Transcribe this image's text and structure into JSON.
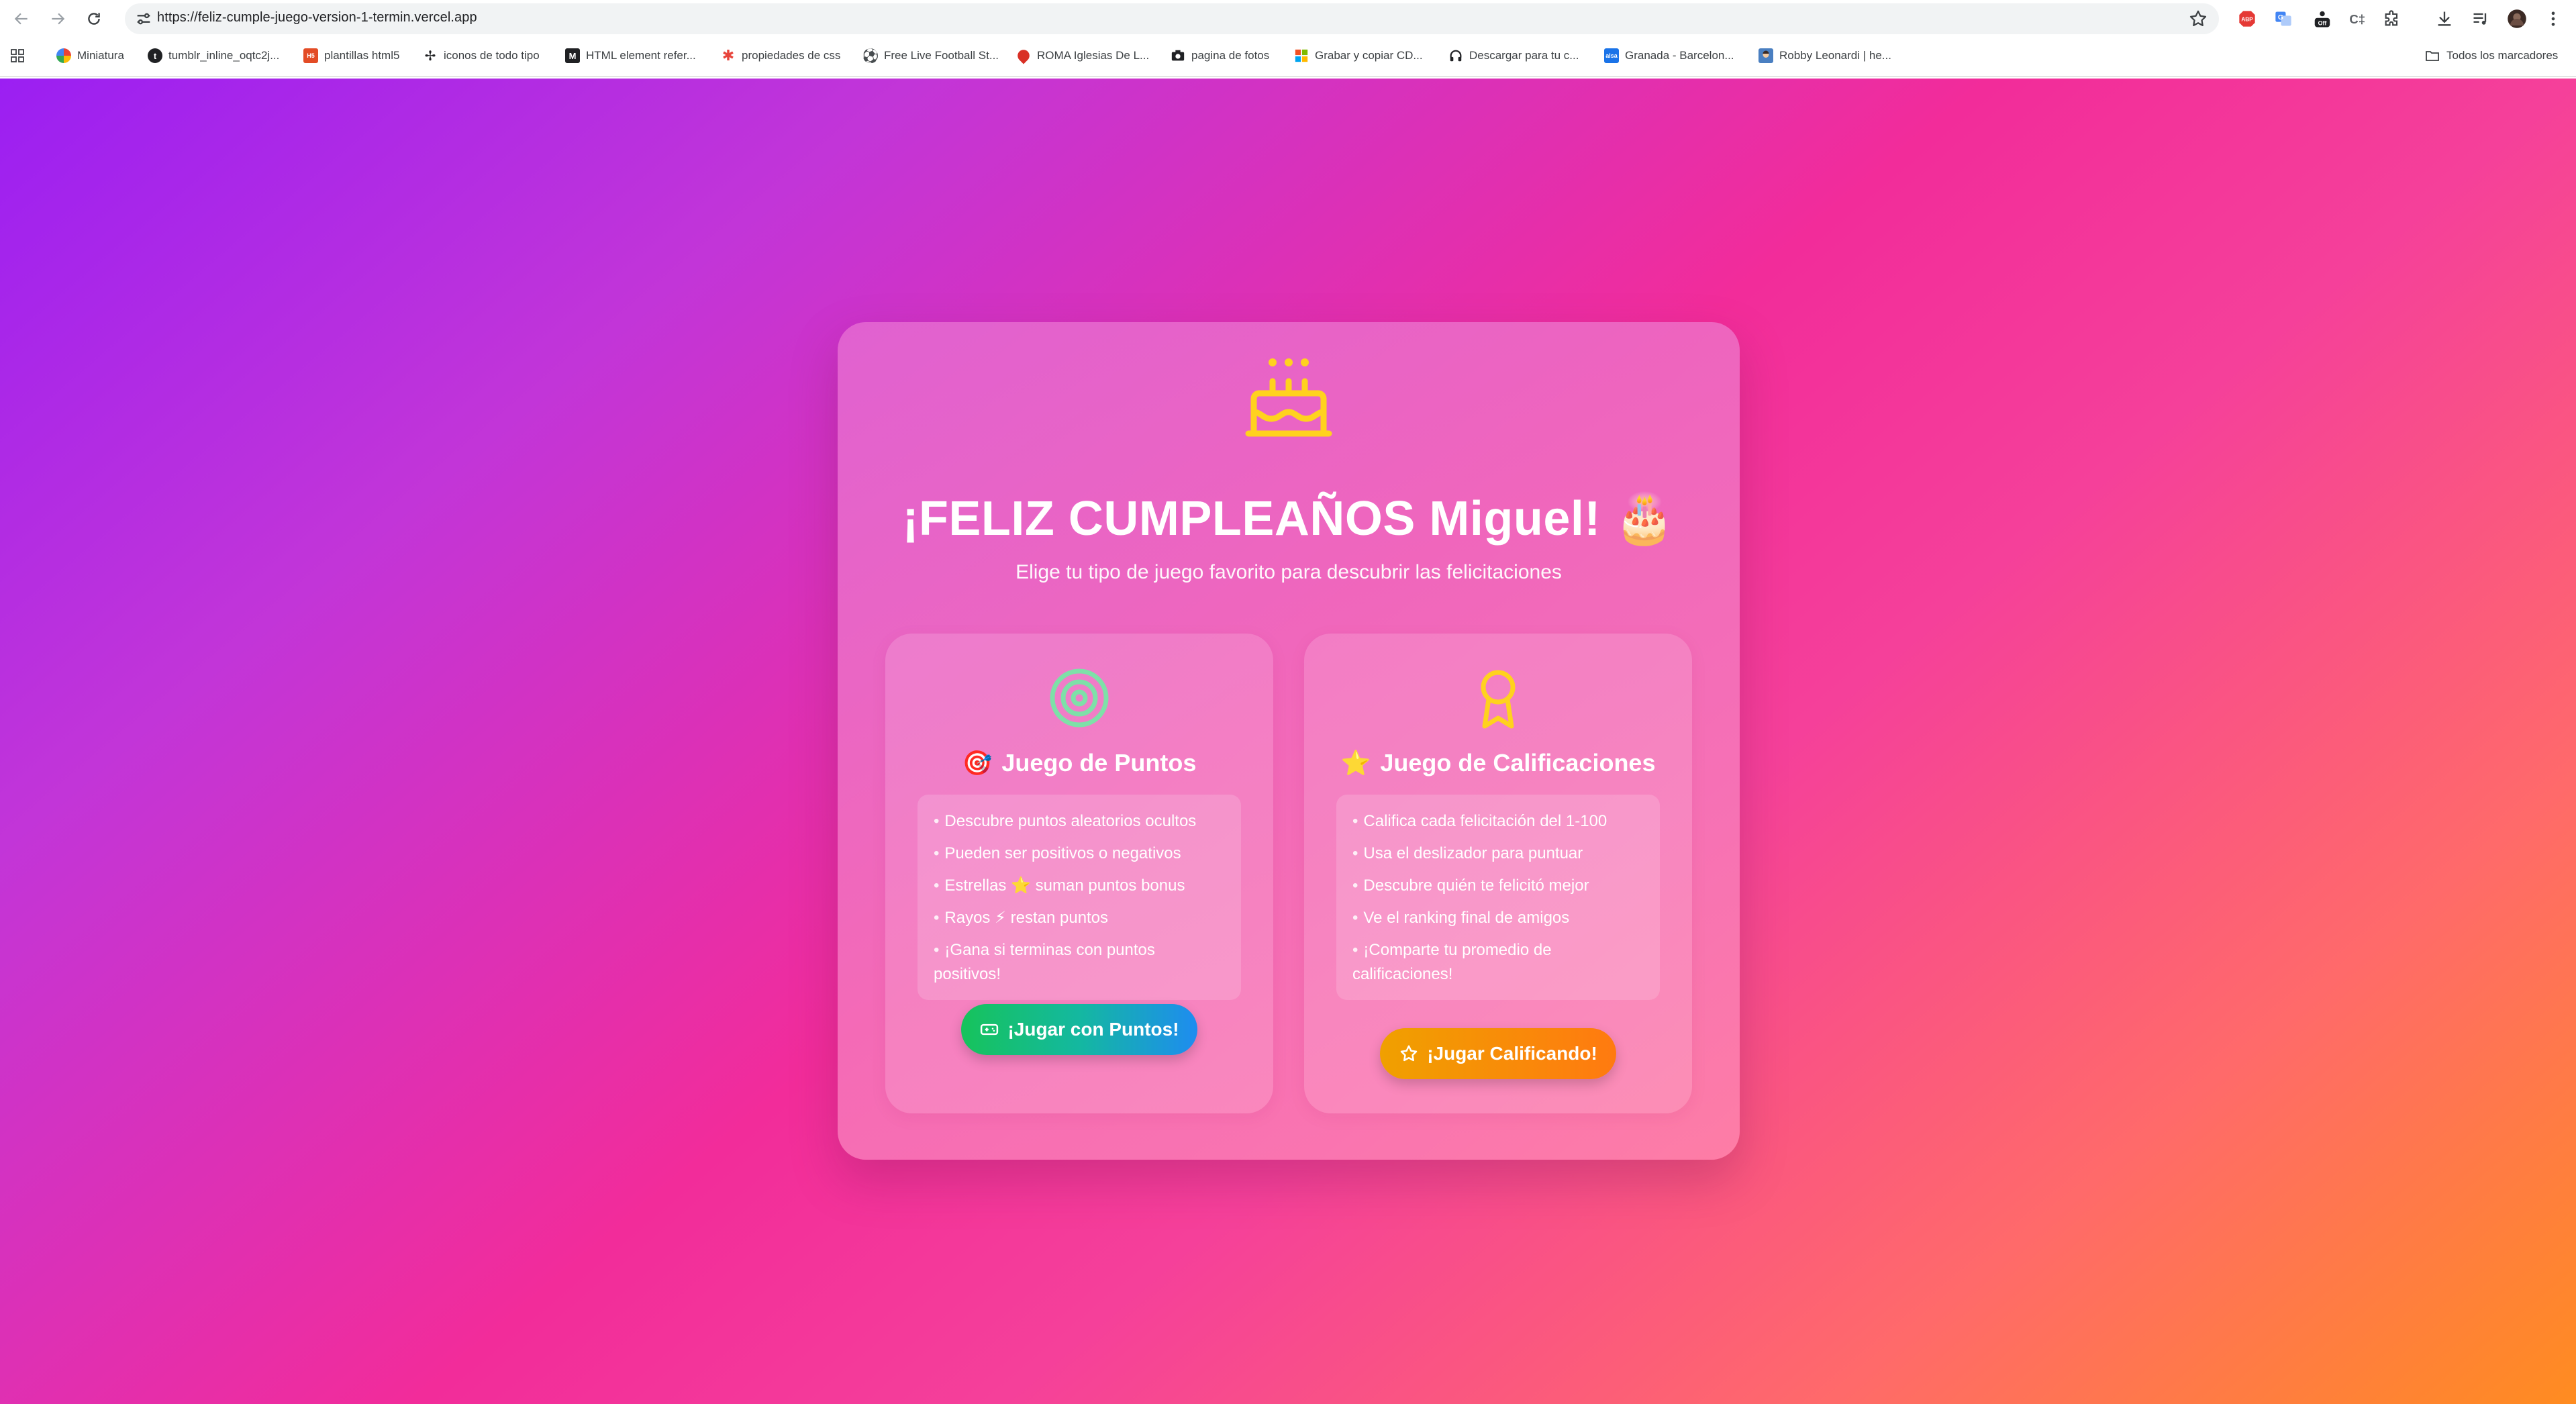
{
  "browser": {
    "url": "https://feliz-cumple-juego-version-1-termin.vercel.app",
    "bookmarks": [
      {
        "label": "Miniatura",
        "icon": "pinwheel-icon",
        "color": "#fbbc05"
      },
      {
        "label": "tumblr_inline_oqtc2j...",
        "icon": "tumblr-icon",
        "color": "#202124"
      },
      {
        "label": "plantillas html5",
        "icon": "html-icon",
        "color": "#e34c26"
      },
      {
        "label": "iconos de todo tipo",
        "icon": "cross-icon",
        "color": "#202124"
      },
      {
        "label": "HTML element refer...",
        "icon": "mdn-icon",
        "color": "#202124"
      },
      {
        "label": "propiedades de css",
        "icon": "asterisk-icon",
        "color": "#e8453c"
      },
      {
        "label": "Free Live Football St...",
        "icon": "football-icon",
        "color": "#202124"
      },
      {
        "label": "ROMA Iglesias De L...",
        "icon": "map-pin-icon",
        "color": "#d93025"
      },
      {
        "label": "pagina de fotos",
        "icon": "camera-icon",
        "color": "#202124"
      },
      {
        "label": "Grabar y copiar CD...",
        "icon": "windows-icon",
        "color": "#00a4ef"
      },
      {
        "label": "Descargar para tu c...",
        "icon": "headphones-icon",
        "color": "#202124"
      },
      {
        "label": "Granada - Barcelon...",
        "icon": "train-icon",
        "color": "#1a73e8"
      },
      {
        "label": "Robby Leonardi | he...",
        "icon": "robby-icon",
        "color": "#4a7fc1"
      }
    ],
    "all_bookmarks": "Todos los marcadores"
  },
  "page": {
    "title": "¡FELIZ CUMPLEAÑOS Miguel!",
    "title_emoji": "🎂",
    "subtitle": "Elige tu tipo de juego favorito para descubrir las felicitaciones",
    "games": [
      {
        "icon": "target-icon",
        "emoji": "🎯",
        "title": "Juego de Puntos",
        "rules": [
          "Descubre puntos aleatorios ocultos",
          "Pueden ser positivos o negativos",
          "Estrellas ⭐ suman puntos bonus",
          "Rayos ⚡ restan puntos",
          "¡Gana si terminas con puntos positivos!"
        ],
        "button": "¡Jugar con Puntos!"
      },
      {
        "icon": "award-icon",
        "emoji": "⭐",
        "title": "Juego de Calificaciones",
        "rules": [
          "Califica cada felicitación del 1-100",
          "Usa el deslizador para puntuar",
          "Descubre quién te felicitó mejor",
          "Ve el ranking final de amigos",
          "¡Comparte tu promedio de calificaciones!"
        ],
        "button": "¡Jugar Calificando!"
      }
    ]
  },
  "colors": {
    "gradient_start": "#9b1ff2",
    "gradient_mid": "#f22c9a",
    "gradient_end": "#ff8c20",
    "cake_icon": "#ffd21e",
    "target_icon": "#7ee0a8",
    "award_icon": "#ffd21e",
    "points_button": "#16c35b",
    "ratings_button": "#ff7a10"
  }
}
